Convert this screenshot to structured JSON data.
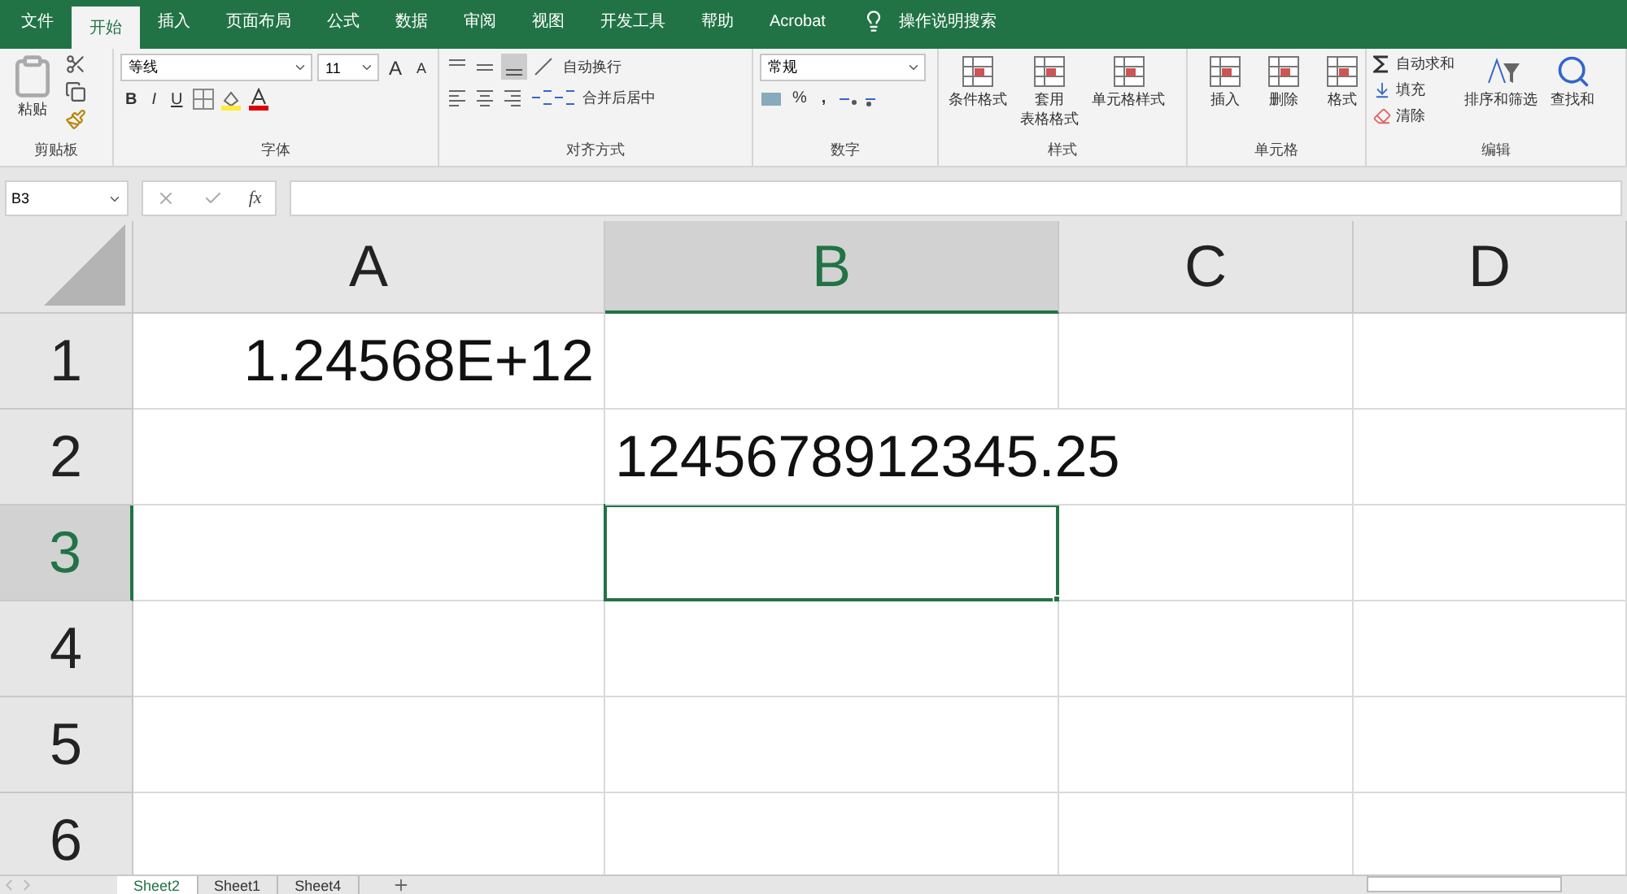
{
  "ribbon_tabs": [
    {
      "label": "文件",
      "selected": false
    },
    {
      "label": "开始",
      "selected": true
    },
    {
      "label": "插入",
      "selected": false
    },
    {
      "label": "页面布局",
      "selected": false
    },
    {
      "label": "公式",
      "selected": false
    },
    {
      "label": "数据",
      "selected": false
    },
    {
      "label": "审阅",
      "selected": false
    },
    {
      "label": "视图",
      "selected": false
    },
    {
      "label": "开发工具",
      "selected": false
    },
    {
      "label": "帮助",
      "selected": false
    },
    {
      "label": "Acrobat",
      "selected": false
    }
  ],
  "tell_me": {
    "placeholder": "操作说明搜索"
  },
  "clipboard": {
    "paste": "粘贴",
    "label": "剪贴板"
  },
  "font": {
    "name": "等线",
    "size": "11",
    "grow": "A",
    "shrink": "A",
    "bold": "B",
    "italic": "I",
    "underline": "U",
    "label": "字体"
  },
  "alignment": {
    "wrap": "自动换行",
    "merge": "合并后居中",
    "label": "对齐方式"
  },
  "number": {
    "format": "常规",
    "percent": "%",
    "comma": ",",
    "label": "数字"
  },
  "styles": {
    "conditional": "条件格式",
    "table_line1": "套用",
    "table_line2": "表格格式",
    "cell_styles": "单元格样式",
    "label": "样式"
  },
  "cells": {
    "insert": "插入",
    "delete": "删除",
    "format": "格式",
    "label": "单元格"
  },
  "editing": {
    "autosum": "自动求和",
    "fill": "填充",
    "clear": "清除",
    "sort": "排序和筛选",
    "find": "查找和",
    "label": "编辑"
  },
  "formula_bar": {
    "name_box": "B3",
    "insert_function": "fx"
  },
  "columns": [
    {
      "label": "A",
      "selected": false
    },
    {
      "label": "B",
      "selected": true
    },
    {
      "label": "C",
      "selected": false
    },
    {
      "label": "D",
      "selected": false
    }
  ],
  "rows": [
    {
      "label": "1",
      "selected": false,
      "cells": [
        {
          "kind": "number",
          "text": "1.24568E+12",
          "selected": false
        },
        {
          "selected": false
        },
        {
          "selected": false
        },
        {
          "selected": false
        }
      ]
    },
    {
      "label": "2",
      "selected": false,
      "cells": [
        {
          "selected": false
        },
        {
          "kind": "overflow",
          "text": "1245678912345.25",
          "selected": false
        },
        {
          "selected": false
        }
      ]
    },
    {
      "label": "3",
      "selected": true,
      "cells": [
        {
          "selected": false
        },
        {
          "selected": true
        },
        {
          "selected": false
        },
        {
          "selected": false
        }
      ]
    },
    {
      "label": "4",
      "selected": false,
      "cells": [
        {
          "selected": false
        },
        {
          "selected": false
        },
        {
          "selected": false
        },
        {
          "selected": false
        }
      ]
    },
    {
      "label": "5",
      "selected": false,
      "cells": [
        {
          "selected": false
        },
        {
          "selected": false
        },
        {
          "selected": false
        },
        {
          "selected": false
        }
      ]
    },
    {
      "label": "6",
      "selected": false,
      "cells": [
        {
          "selected": false
        },
        {
          "selected": false
        },
        {
          "selected": false
        },
        {
          "selected": false
        }
      ]
    }
  ],
  "sheet_tabs": [
    {
      "label": "Sheet2",
      "selected": true
    },
    {
      "label": "Sheet1",
      "selected": false
    },
    {
      "label": "Sheet4",
      "selected": false
    }
  ]
}
